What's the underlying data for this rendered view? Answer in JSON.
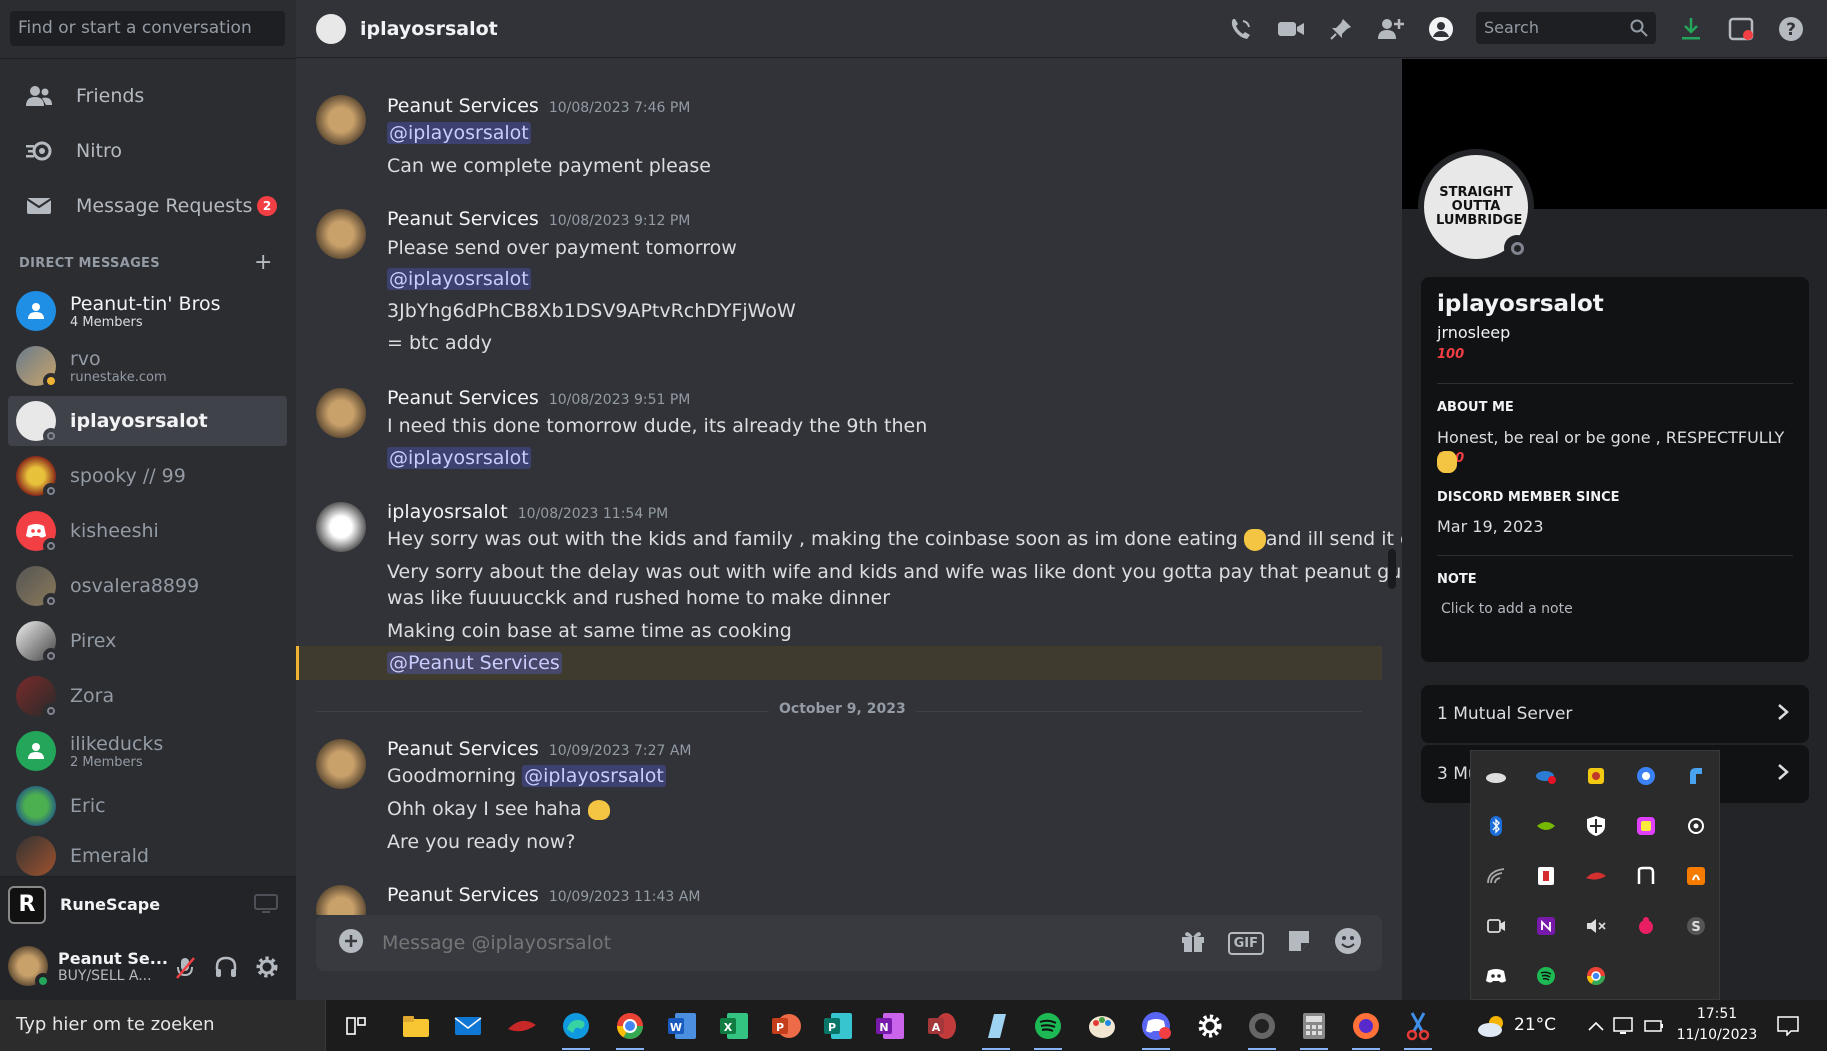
{
  "sidebar": {
    "search_placeholder": "Find or start a conversation",
    "nav": [
      {
        "label": "Friends"
      },
      {
        "label": "Nitro"
      },
      {
        "label": "Message Requests",
        "badge": "2"
      }
    ],
    "dm_header": "DIRECT MESSAGES",
    "dms": [
      {
        "name": "Peanut-tin' Bros",
        "sub": "4 Members"
      },
      {
        "name": "rvo",
        "sub": "runestake.com"
      },
      {
        "name": "iplayosrsalot",
        "sub": ""
      },
      {
        "name": "spooky // 99",
        "sub": ""
      },
      {
        "name": "kisheeshi",
        "sub": ""
      },
      {
        "name": "osvalera8899",
        "sub": ""
      },
      {
        "name": "Pirex",
        "sub": ""
      },
      {
        "name": "Zora",
        "sub": ""
      },
      {
        "name": "ilikeducks",
        "sub": "2 Members"
      },
      {
        "name": "Eric",
        "sub": ""
      },
      {
        "name": "Emerald",
        "sub": ""
      }
    ],
    "activity": "RuneScape",
    "user": {
      "name": "Peanut Se...",
      "status": "BUY/SELL A..."
    }
  },
  "header": {
    "channel": "iplayosrsalot",
    "search_placeholder": "Search"
  },
  "messages": {
    "m1": {
      "author": "Peanut Services",
      "time": "10/08/2023 7:46 PM",
      "l1": "@iplayosrsalot",
      "l2": "Can we complete payment please"
    },
    "m2": {
      "author": "Peanut Services",
      "time": "10/08/2023 9:12 PM",
      "l1": "Please send over payment tomorrow",
      "l2": "@iplayosrsalot",
      "l3": "3JbYhg6dPhCB8Xb1DSV9APtvRchDYFjWoW",
      "l4": "= btc addy"
    },
    "m3": {
      "author": "Peanut Services",
      "time": "10/08/2023 9:51 PM",
      "l1": "I need this done tomorrow dude, its already the 9th then",
      "l2": "@iplayosrsalot"
    },
    "m4": {
      "author": "iplayosrsalot",
      "time": "10/08/2023 11:54 PM",
      "l1a": "Hey sorry was out with the kids and family , making the coinbase soon as im done eating",
      "l1b": "and ill send it over",
      "l2": "Very sorry about the delay was out with wife and kids and wife was like dont you gotta pay that peanut  guy .. I",
      "l3": "was like fuuuucckk and rushed home to make dinner",
      "l4": "Making coin base at same time as cooking",
      "l5": "@Peanut Services"
    },
    "date_divider": "October 9, 2023",
    "m5": {
      "author": "Peanut Services",
      "time": "10/09/2023 7:27 AM",
      "l1a": "Goodmorning",
      "l1b": "@iplayosrsalot",
      "l2": "Ohh okay I see haha",
      "l3": "Are you ready now?"
    },
    "m6": {
      "author": "Peanut Services",
      "time": "10/09/2023 11:43 AM"
    }
  },
  "composer": {
    "placeholder": "Message @iplayosrsalot",
    "gif": "GIF"
  },
  "profile": {
    "display_name": "iplayosrsalot",
    "username": "jrnosleep",
    "about_title": "ABOUT ME",
    "about_text": "Honest, be real or be gone , RESPECTFULLY",
    "member_title": "DISCORD MEMBER SINCE",
    "member_since": "Mar 19, 2023",
    "note_title": "NOTE",
    "note_placeholder": "Click to add a note",
    "mutual_servers": "1 Mutual Server",
    "mutual_friends_partial": "3 Mu",
    "avatar_text": "STRAIGHT OUTTA LUMBRIDGE"
  },
  "taskbar": {
    "search": "Typ hier om te zoeken",
    "temperature": "21°C",
    "time": "17:51",
    "date": "11/10/2023"
  },
  "colors": {
    "accent": "#5865f2",
    "mention_bg": "#3c4270",
    "highlight": "#f0b232",
    "badge": "#f23f43"
  }
}
